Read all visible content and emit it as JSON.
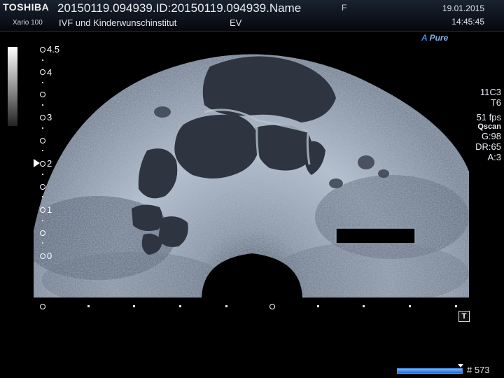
{
  "header": {
    "brand": "TOSHIBA",
    "model": "Xario 100",
    "study_title": "20150119.094939.ID:20150119.094939.Name",
    "institution": "IVF und Kinderwunschinstitut",
    "preset": "EV",
    "sex": "F",
    "date": "19.01.2015",
    "time": "14:45:45"
  },
  "image_mode": {
    "a_label": "A",
    "pure_label": "Pure"
  },
  "depth_scale": {
    "labels": [
      "4.5",
      "4",
      "3",
      "2",
      "1",
      "0"
    ]
  },
  "right_panel": {
    "probe": "11C3",
    "preset_t": "T6",
    "frame_rate": "51 fps",
    "qscan": "Qscan",
    "gain": "G:98",
    "dynamic_range": "DR:65",
    "a_value": "A:3"
  },
  "controls": {
    "t_label": "T",
    "frame_count": "# 573",
    "cine_progress": 0.98
  },
  "colors": {
    "tissue_light": "#c8d2de",
    "tissue_mid": "#6e7a8c",
    "fluid": "#2e3540",
    "accent_blue": "#3f8fdc"
  }
}
